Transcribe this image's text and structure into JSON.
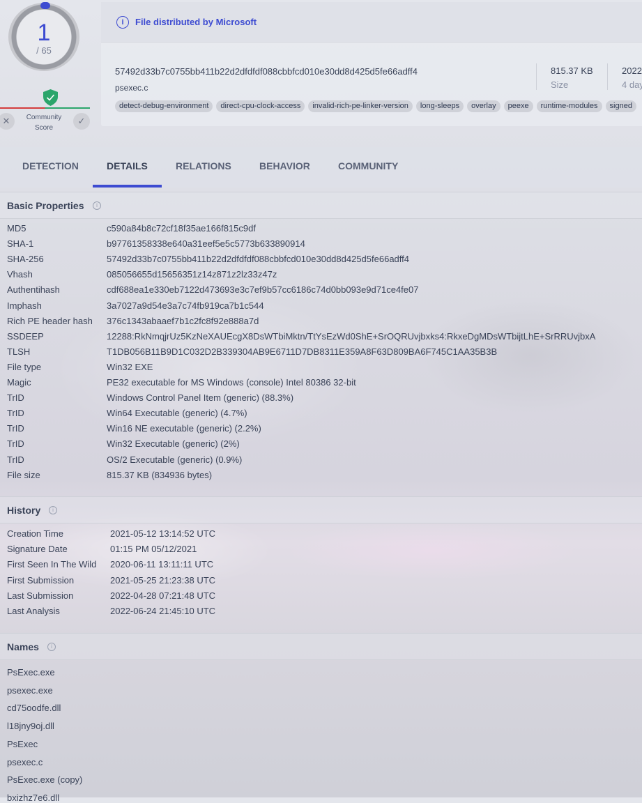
{
  "score": {
    "detections": "1",
    "total": "/ 65"
  },
  "community": {
    "label_line1": "Community",
    "label_line2": "Score"
  },
  "notice": {
    "text": "File distributed by Microsoft"
  },
  "file": {
    "sha256": "57492d33b7c0755bb411b22d2dfdfdf088cbbfcd010e30dd8d425d5fe66adff4",
    "name": "psexec.c",
    "size_value": "815.37 KB",
    "size_label": "Size",
    "date_value": "2022",
    "date_label": "4 day"
  },
  "tags": [
    "detect-debug-environment",
    "direct-cpu-clock-access",
    "invalid-rich-pe-linker-version",
    "long-sleeps",
    "overlay",
    "peexe",
    "runtime-modules",
    "signed"
  ],
  "tabs": [
    "DETECTION",
    "DETAILS",
    "RELATIONS",
    "BEHAVIOR",
    "COMMUNITY"
  ],
  "basic": {
    "title": "Basic Properties",
    "rows": [
      {
        "k": "MD5",
        "v": "c590a84b8c72cf18f35ae166f815c9df"
      },
      {
        "k": "SHA-1",
        "v": "b97761358338e640a31eef5e5c5773b633890914"
      },
      {
        "k": "SHA-256",
        "v": "57492d33b7c0755bb411b22d2dfdfdf088cbbfcd010e30dd8d425d5fe66adff4"
      },
      {
        "k": "Vhash",
        "v": "085056655d15656351z14z871z2lz33z47z"
      },
      {
        "k": "Authentihash",
        "v": "cdf688ea1e330eb7122d473693e3c7ef9b57cc6186c74d0bb093e9d71ce4fe07"
      },
      {
        "k": "Imphash",
        "v": "3a7027a9d54e3a7c74fb919ca7b1c544"
      },
      {
        "k": "Rich PE header hash",
        "v": "376c1343abaaef7b1c2fc8f92e888a7d"
      },
      {
        "k": "SSDEEP",
        "v": "12288:RkNmqjrUz5KzNeXAUEcgX8DsWTbiMktn/TtYsEzWd0ShE+SrOQRUvjbxks4:RkxeDgMDsWTbijtLhE+SrRRUvjbxA"
      },
      {
        "k": "TLSH",
        "v": "T1DB056B11B9D1C032D2B339304AB9E6711D7DB8311E359A8F63D809BA6F745C1AA35B3B"
      },
      {
        "k": "File type",
        "v": "Win32 EXE"
      },
      {
        "k": "Magic",
        "v": "PE32 executable for MS Windows (console) Intel 80386 32-bit"
      },
      {
        "k": "TrID",
        "v": "Windows Control Panel Item (generic) (88.3%)"
      },
      {
        "k": "TrID",
        "v": "Win64 Executable (generic) (4.7%)"
      },
      {
        "k": "TrID",
        "v": "Win16 NE executable (generic) (2.2%)"
      },
      {
        "k": "TrID",
        "v": "Win32 Executable (generic) (2%)"
      },
      {
        "k": "TrID",
        "v": "OS/2 Executable (generic) (0.9%)"
      },
      {
        "k": "File size",
        "v": "815.37 KB (834936 bytes)"
      }
    ]
  },
  "history": {
    "title": "History",
    "rows": [
      {
        "k": "Creation Time",
        "v": "2021-05-12 13:14:52 UTC"
      },
      {
        "k": "Signature Date",
        "v": "01:15 PM 05/12/2021"
      },
      {
        "k": "First Seen In The Wild",
        "v": "2020-06-11 13:11:11 UTC"
      },
      {
        "k": "First Submission",
        "v": "2021-05-25 21:23:38 UTC"
      },
      {
        "k": "Last Submission",
        "v": "2022-04-28 07:21:48 UTC"
      },
      {
        "k": "Last Analysis",
        "v": "2022-06-24 21:45:10 UTC"
      }
    ]
  },
  "names": {
    "title": "Names",
    "items": [
      "PsExec.exe",
      "psexec.exe",
      "cd75oodfe.dll",
      "l18jny9oj.dll",
      "PsExec",
      "psexec.c",
      "PsExec.exe (copy)",
      "bxizhz7e6.dll"
    ]
  }
}
